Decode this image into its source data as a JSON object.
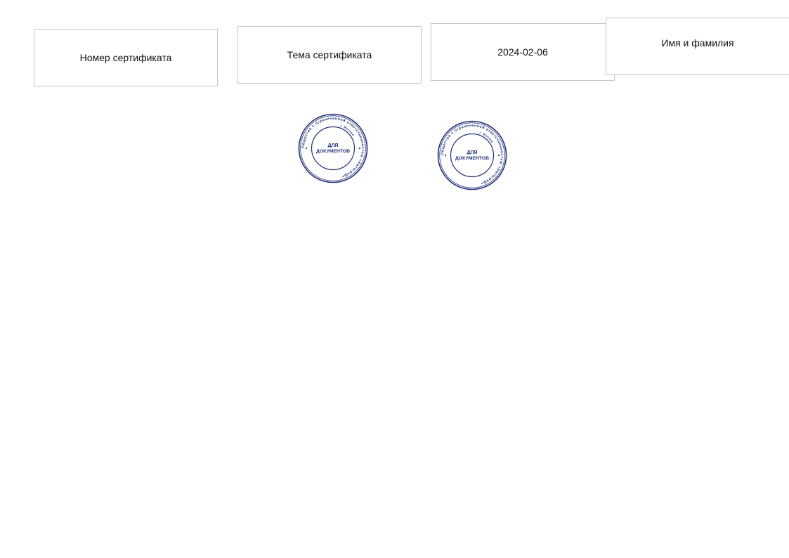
{
  "fields": {
    "certificate_number": "Номер сертификата",
    "certificate_topic": "Тема сертификата",
    "date": "2024-02-06",
    "full_name": "Имя и фамилия"
  },
  "stamps": [
    {
      "center_line1": "ДЛЯ",
      "center_line2": "ДОКУМЕНТОВ",
      "outer_ring_text": "Общество с ограниченной ответственностью «Автограф»",
      "inner_ring_text": "г. Москва",
      "color": "#1f2f7a"
    },
    {
      "center_line1": "ДЛЯ",
      "center_line2": "ДОКУМЕНТОВ",
      "outer_ring_text": "Общество с ограниченной ответственностью «Автограф»",
      "inner_ring_text": "г. Москва",
      "color": "#1f2f7a"
    }
  ],
  "colors": {
    "border": "#c4c4c4",
    "stamp_ink": "#1f2f7a",
    "text": "#111111"
  }
}
